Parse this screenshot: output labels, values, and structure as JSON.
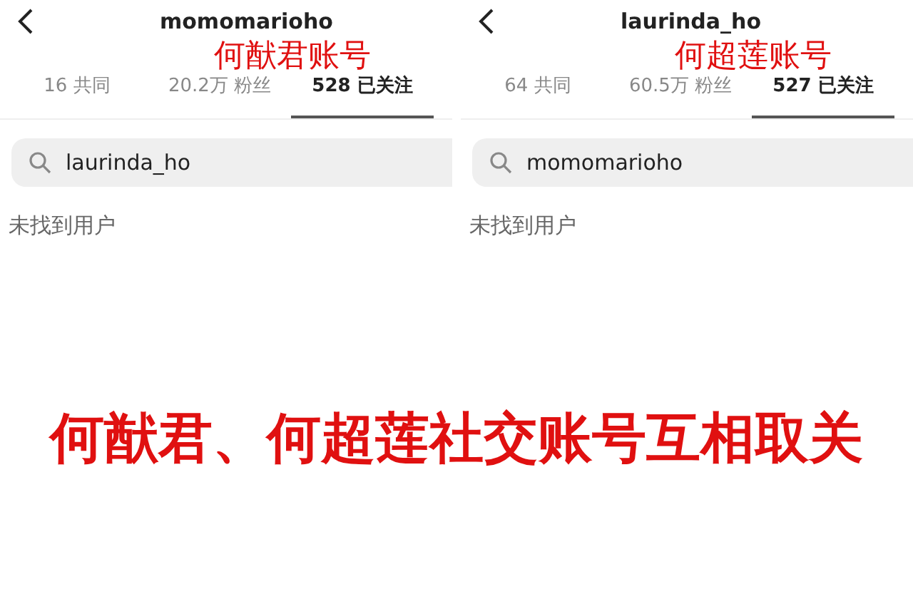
{
  "panels": [
    {
      "title": "momomarioho",
      "label": "何猷君账号",
      "tabs": [
        {
          "label": "16 共同",
          "selected": false
        },
        {
          "label": "20.2万 粉丝",
          "selected": false
        },
        {
          "label": "528 已关注",
          "selected": true
        }
      ],
      "search": {
        "value": "laurinda_ho"
      },
      "message": "未找到用户"
    },
    {
      "title": "laurinda_ho",
      "label": "何超莲账号",
      "tabs": [
        {
          "label": "64 共同",
          "selected": false
        },
        {
          "label": "60.5万 粉丝",
          "selected": false
        },
        {
          "label": "527 已关注",
          "selected": true
        }
      ],
      "search": {
        "value": "momomarioho"
      },
      "message": "未找到用户"
    }
  ],
  "caption": "何猷君、何超莲社交账号互相取关"
}
